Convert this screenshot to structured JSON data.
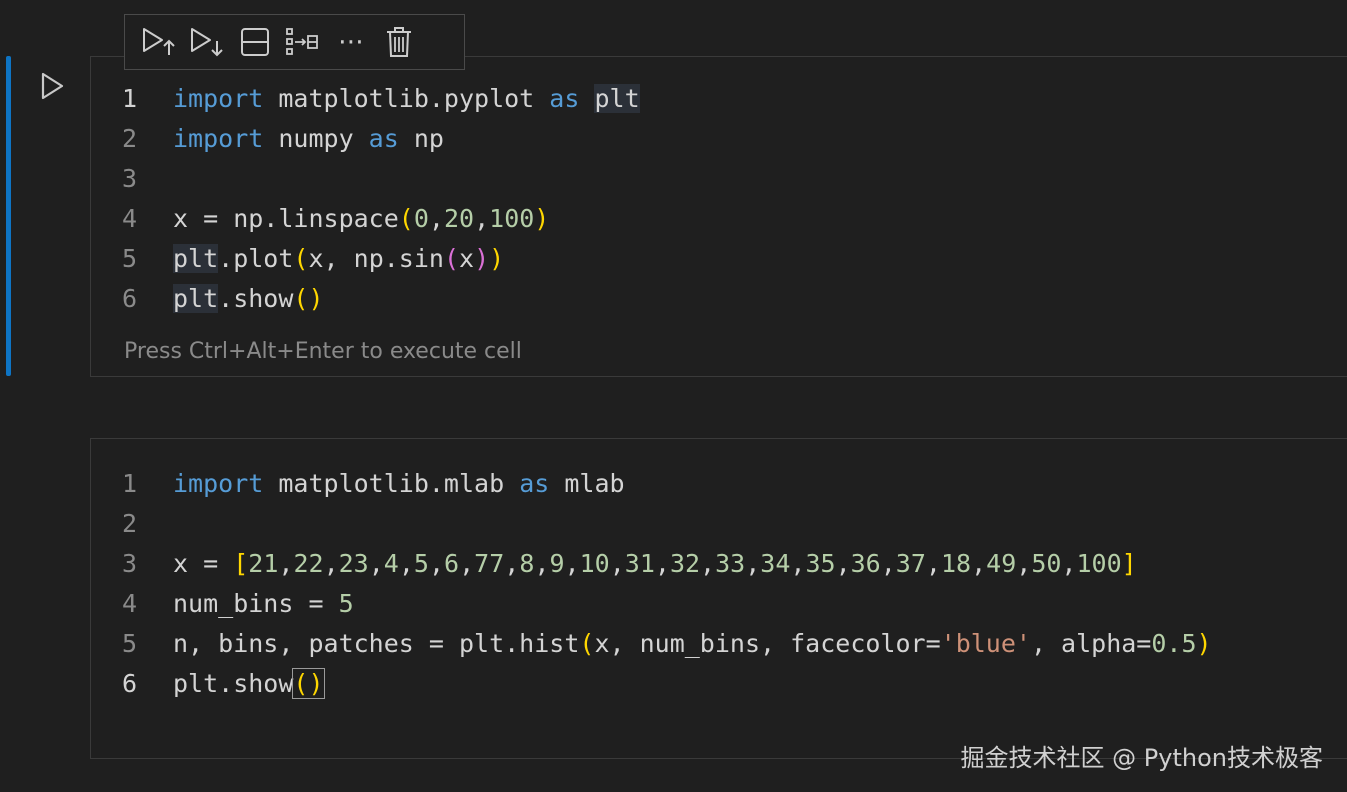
{
  "toolbar": {
    "items": [
      {
        "name": "run-above-icon"
      },
      {
        "name": "run-below-icon"
      },
      {
        "name": "split-cell-icon"
      },
      {
        "name": "join-cells-icon"
      },
      {
        "name": "more-actions-icon",
        "label": "⋯"
      },
      {
        "name": "delete-cell-icon"
      }
    ]
  },
  "cells": [
    {
      "line_numbers": [
        "1",
        "2",
        "3",
        "4",
        "5",
        "6"
      ],
      "hint": "Press Ctrl+Alt+Enter to execute cell"
    },
    {
      "line_numbers": [
        "1",
        "2",
        "3",
        "4",
        "5",
        "6"
      ]
    }
  ],
  "watermark": "掘金技术社区 @ Python技术极客",
  "colors": {
    "background": "#1f1f1f",
    "focus_bar": "#0e74c4",
    "keyword": "#569cd6",
    "number": "#b5cea8",
    "string": "#ce9178",
    "bracket_level1": "#ffd700",
    "bracket_level2": "#da70d6"
  }
}
